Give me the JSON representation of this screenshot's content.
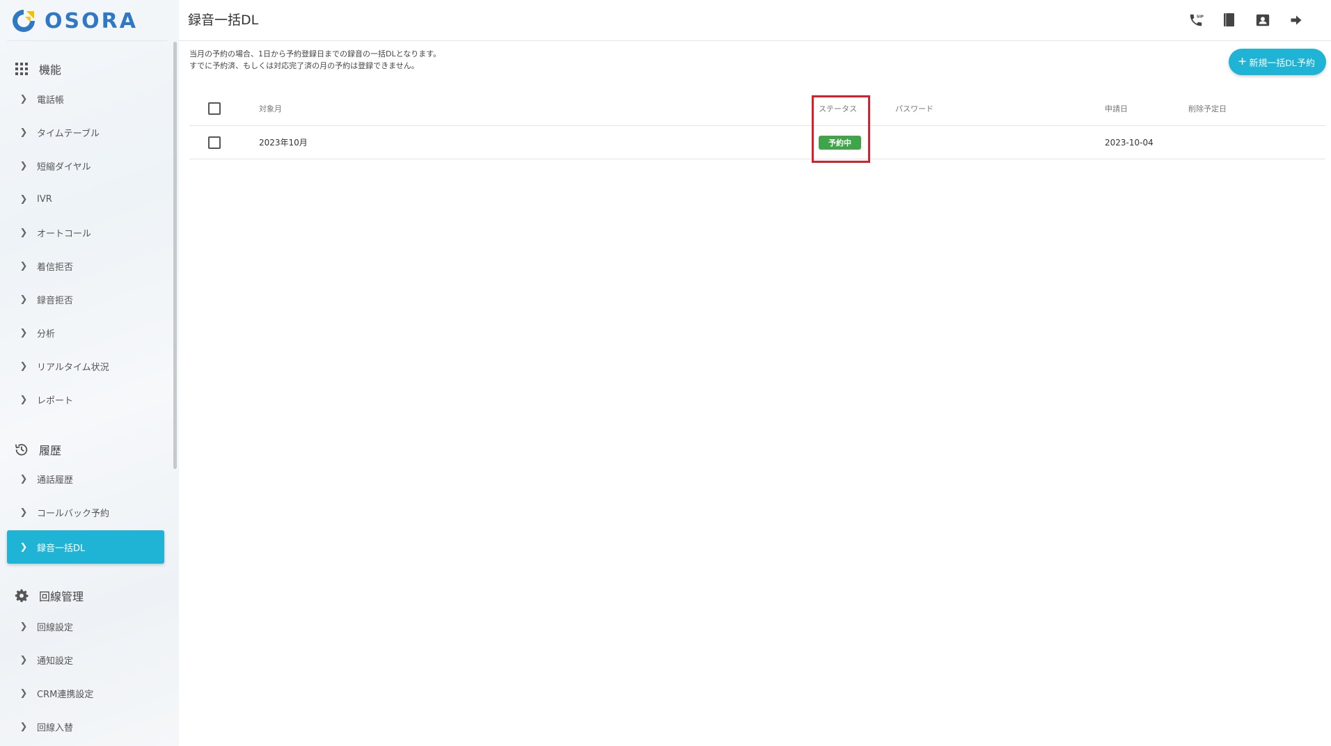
{
  "app": {
    "logo_text": "OSORA",
    "logo_colors": [
      "#2f78c4",
      "#f2c200"
    ]
  },
  "accent_color": "#1fb3d6",
  "sidebar": {
    "sections": [
      {
        "label": "機能",
        "icon": "grid-icon",
        "items": [
          {
            "label": "電話帳"
          },
          {
            "label": "タイムテーブル"
          },
          {
            "label": "短縮ダイヤル"
          },
          {
            "label": "IVR"
          },
          {
            "label": "オートコール"
          },
          {
            "label": "着信拒否"
          },
          {
            "label": "録音拒否"
          },
          {
            "label": "分析"
          },
          {
            "label": "リアルタイム状況"
          },
          {
            "label": "レポート"
          }
        ]
      },
      {
        "label": "履歴",
        "icon": "history-icon",
        "items": [
          {
            "label": "通話履歴"
          },
          {
            "label": "コールバック予約"
          },
          {
            "label": "録音一括DL",
            "active": true
          }
        ]
      },
      {
        "label": "回線管理",
        "icon": "gear-icon",
        "items": [
          {
            "label": "回線設定"
          },
          {
            "label": "通知設定"
          },
          {
            "label": "CRM連携設定"
          },
          {
            "label": "回線入替"
          }
        ]
      }
    ]
  },
  "header": {
    "title": "録音一括DL",
    "icons": [
      "sip-phone-icon",
      "book-icon",
      "contact-card-icon",
      "logout-arrow-icon"
    ]
  },
  "main": {
    "notice_line1": "当月の予約の場合、1日から予約登録日までの録音の一括DLとなります。",
    "notice_line2": "すでに予約済、もしくは対応完了済の月の予約は登録できません。",
    "new_button_label": "新規一括DL予約",
    "table": {
      "headers": {
        "month": "対象月",
        "status": "ステータス",
        "password": "パスワード",
        "applied": "申請日",
        "delete_date": "削除予定日"
      },
      "rows": [
        {
          "month": "2023年10月",
          "status": "予約中",
          "password": "",
          "applied": "2023-10-04",
          "delete_date": ""
        }
      ]
    },
    "status_color": "#3ea648",
    "highlight_color": "#d6202c"
  }
}
